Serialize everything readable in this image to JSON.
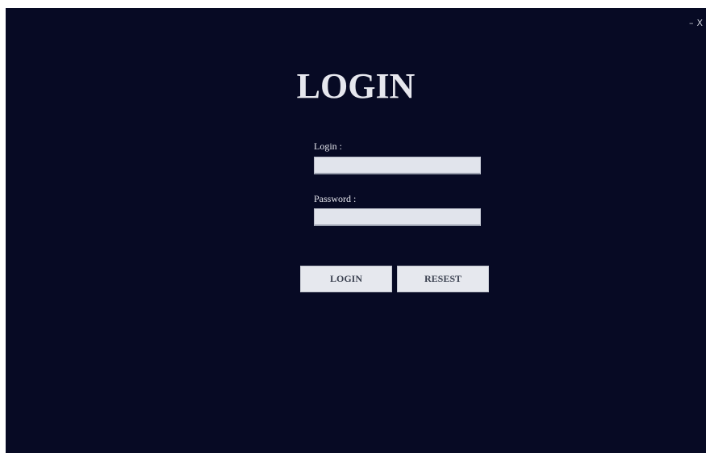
{
  "window": {
    "controls": {
      "minimize": "–",
      "close": "X"
    }
  },
  "form": {
    "title": "LOGIN",
    "login_label": "Login :",
    "login_value": "",
    "password_label": "Password :",
    "password_value": ""
  },
  "buttons": {
    "login": "LOGIN",
    "reset": "RESEST"
  },
  "colors": {
    "background": "#070a24",
    "text": "#e6e7ee",
    "field": "#e1e4ec",
    "button": "#e6e8ee"
  }
}
